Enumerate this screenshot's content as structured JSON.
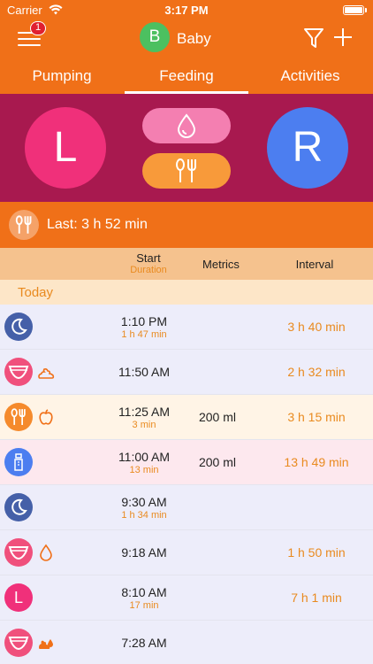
{
  "status_bar": {
    "carrier": "Carrier",
    "time": "3:17 PM"
  },
  "nav": {
    "menu_badge": "1",
    "baby_initial": "B",
    "baby_name": "Baby"
  },
  "tabs": [
    {
      "label": "Pumping"
    },
    {
      "label": "Feeding"
    },
    {
      "label": "Activities"
    }
  ],
  "panel": {
    "left_label": "L",
    "right_label": "R"
  },
  "last": {
    "text": "Last: 3 h 52 min"
  },
  "columns": {
    "start": "Start",
    "duration": "Duration",
    "metrics": "Metrics",
    "interval": "Interval"
  },
  "section": {
    "today": "Today"
  },
  "colors": {
    "orange": "#f07018",
    "magenta": "#a8194f",
    "pink": "#f0307a",
    "blue": "#4c7ef0",
    "duration_orange": "#e98a1f"
  },
  "rows": [
    {
      "type": "sleep",
      "icon": "moon-icon",
      "start": "1:10 PM",
      "duration": "1 h 47 min",
      "metric": "",
      "interval": "3 h 40 min"
    },
    {
      "type": "diaper",
      "icon": "diaper-icon",
      "sub_icon": "poop-icon",
      "start": "11:50 AM",
      "duration": "",
      "metric": "",
      "interval": "2 h 32 min"
    },
    {
      "type": "meal",
      "icon": "utensils-icon",
      "sub_icon": "apple-icon",
      "start": "11:25 AM",
      "duration": "3 min",
      "metric": "200 ml",
      "interval": "3 h 15 min"
    },
    {
      "type": "pump",
      "icon": "pump-icon",
      "start": "11:00 AM",
      "duration": "13 min",
      "metric": "200 ml",
      "interval": "13 h 49 min"
    },
    {
      "type": "sleep",
      "icon": "moon-icon",
      "start": "9:30 AM",
      "duration": "1 h 34 min",
      "metric": "",
      "interval": ""
    },
    {
      "type": "diaper",
      "icon": "diaper-icon",
      "sub_icon": "drop-icon",
      "start": "9:18 AM",
      "duration": "",
      "metric": "",
      "interval": "1 h 50 min"
    },
    {
      "type": "breast",
      "icon": "breast-left-icon",
      "icon_label": "L",
      "start": "8:10 AM",
      "duration": "17 min",
      "metric": "",
      "interval": "7 h 1 min"
    },
    {
      "type": "diaper",
      "icon": "diaper-icon",
      "sub_icon": "mixed-icon",
      "start": "7:28 AM",
      "duration": "",
      "metric": "",
      "interval": ""
    }
  ]
}
